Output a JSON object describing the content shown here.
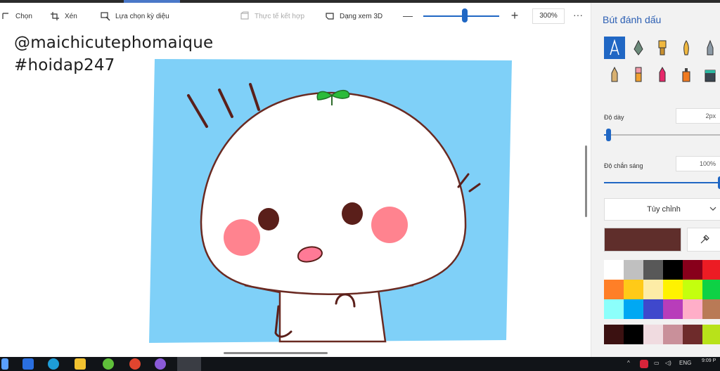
{
  "toolbar": {
    "select_label": "Chọn",
    "crop_label": "Xén",
    "magic_select_label": "Lựa chọn kỳ diệu",
    "mixed_reality_label": "Thực tế kết hợp",
    "view3d_label": "Dạng xem 3D",
    "zoom_value": "300%",
    "zoom_level_fraction": 0.55,
    "more_label": "···"
  },
  "canvas": {
    "caption_line1": "@maichicutephomaique",
    "caption_line2": "#hoidap247",
    "background_color": "#7fd0f8"
  },
  "panel": {
    "title": "Bút đánh dấu",
    "thickness_label": "Độ dày",
    "thickness_value": "2px",
    "thickness_fraction": 0.02,
    "opacity_label": "Độ chắn sáng",
    "opacity_value": "100%",
    "opacity_fraction": 1.0,
    "customize_label": "Tùy chỉnh",
    "current_color": "#5f2e2b",
    "palette": [
      "#ffffff",
      "#c0c0c0",
      "#585858",
      "#000000",
      "#88001b",
      "#ec1c24",
      "#ff7f27",
      "#ffca18",
      "#fdeca6",
      "#fff200",
      "#c4ff0e",
      "#0ed145",
      "#8cfffb",
      "#00a8f3",
      "#3f48cc",
      "#b83dba",
      "#ffaec8",
      "#b97a56"
    ],
    "custom_colors": [
      "#3b1111",
      "#000000",
      "#f0dbe0",
      "#c9909a",
      "#6e2b2b",
      "#b8e21a"
    ]
  },
  "tray": {
    "language": "ENG",
    "time": "9:09 P"
  }
}
